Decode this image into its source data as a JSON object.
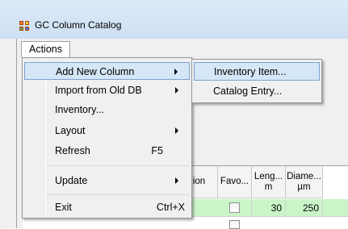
{
  "window": {
    "title": "GC Column Catalog"
  },
  "menubar": {
    "actions_label": "Actions"
  },
  "actions_menu": {
    "items": [
      {
        "label": "Add New Column",
        "shortcut": "",
        "submenu": true,
        "highlighted": true
      },
      {
        "label": "Import from Old DB",
        "shortcut": "",
        "submenu": true
      },
      {
        "label": "Inventory...",
        "shortcut": ""
      },
      {
        "label": "Layout",
        "shortcut": "",
        "submenu": true
      },
      {
        "label": "Refresh",
        "shortcut": "F5"
      },
      {
        "label": "Update",
        "shortcut": "",
        "submenu": true
      },
      {
        "label": "Exit",
        "shortcut": "Ctrl+X"
      }
    ]
  },
  "add_submenu": {
    "items": [
      {
        "label": "Inventory Item...",
        "highlighted": true
      },
      {
        "label": "Catalog Entry..."
      }
    ]
  },
  "grid": {
    "columns": [
      "ion",
      "Favo...",
      "Leng... m",
      "Diame... µm"
    ],
    "rows": [
      {
        "length": "30",
        "diameter": "250"
      }
    ],
    "faint_row_text": "--- -- ---- ---- --- ---"
  }
}
